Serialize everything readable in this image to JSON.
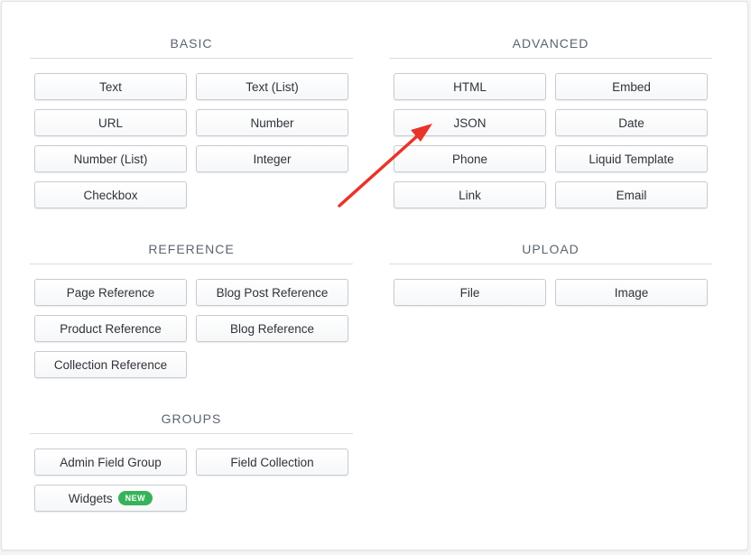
{
  "basic": {
    "title": "BASIC",
    "buttons": [
      "Text",
      "Text (List)",
      "URL",
      "Number",
      "Number (List)",
      "Integer",
      "Checkbox"
    ]
  },
  "advanced": {
    "title": "ADVANCED",
    "buttons": [
      "HTML",
      "Embed",
      "JSON",
      "Date",
      "Phone",
      "Liquid Template",
      "Link",
      "Email"
    ]
  },
  "reference": {
    "title": "REFERENCE",
    "buttons": [
      "Page Reference",
      "Blog Post Reference",
      "Product Reference",
      "Blog Reference",
      "Collection Reference"
    ]
  },
  "upload": {
    "title": "UPLOAD",
    "buttons": [
      "File",
      "Image"
    ]
  },
  "groups": {
    "title": "GROUPS",
    "buttons": [
      "Admin Field Group",
      "Field Collection",
      "Widgets"
    ],
    "new_badge": "NEW"
  },
  "annotation": {
    "arrow_color": "#e8342a",
    "arrow_icon": "red-arrow-icon"
  },
  "colors": {
    "badge_green": "#36b35a"
  }
}
